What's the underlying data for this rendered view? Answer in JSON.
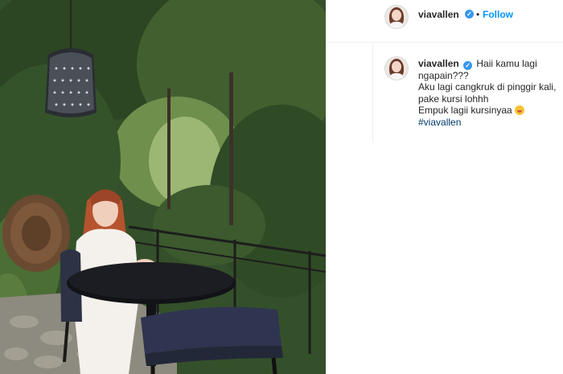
{
  "post": {
    "username": "viavallen",
    "follow_label": "Follow",
    "separator": "•",
    "caption_lines": [
      "Haii kamu lagi",
      "ngapain???",
      "Aku lagi cangkruk di pinggir kali,",
      "pake kursi lohhh",
      "Empuk lagii kursinyaa"
    ],
    "hashtag": "#viavallen"
  },
  "icons": {
    "verified": "verified-badge-icon",
    "emoji": "yum-face-emoji-icon"
  },
  "colors": {
    "follow": "#0095f6",
    "verified": "#3897f0",
    "hashtag": "#00376b"
  }
}
